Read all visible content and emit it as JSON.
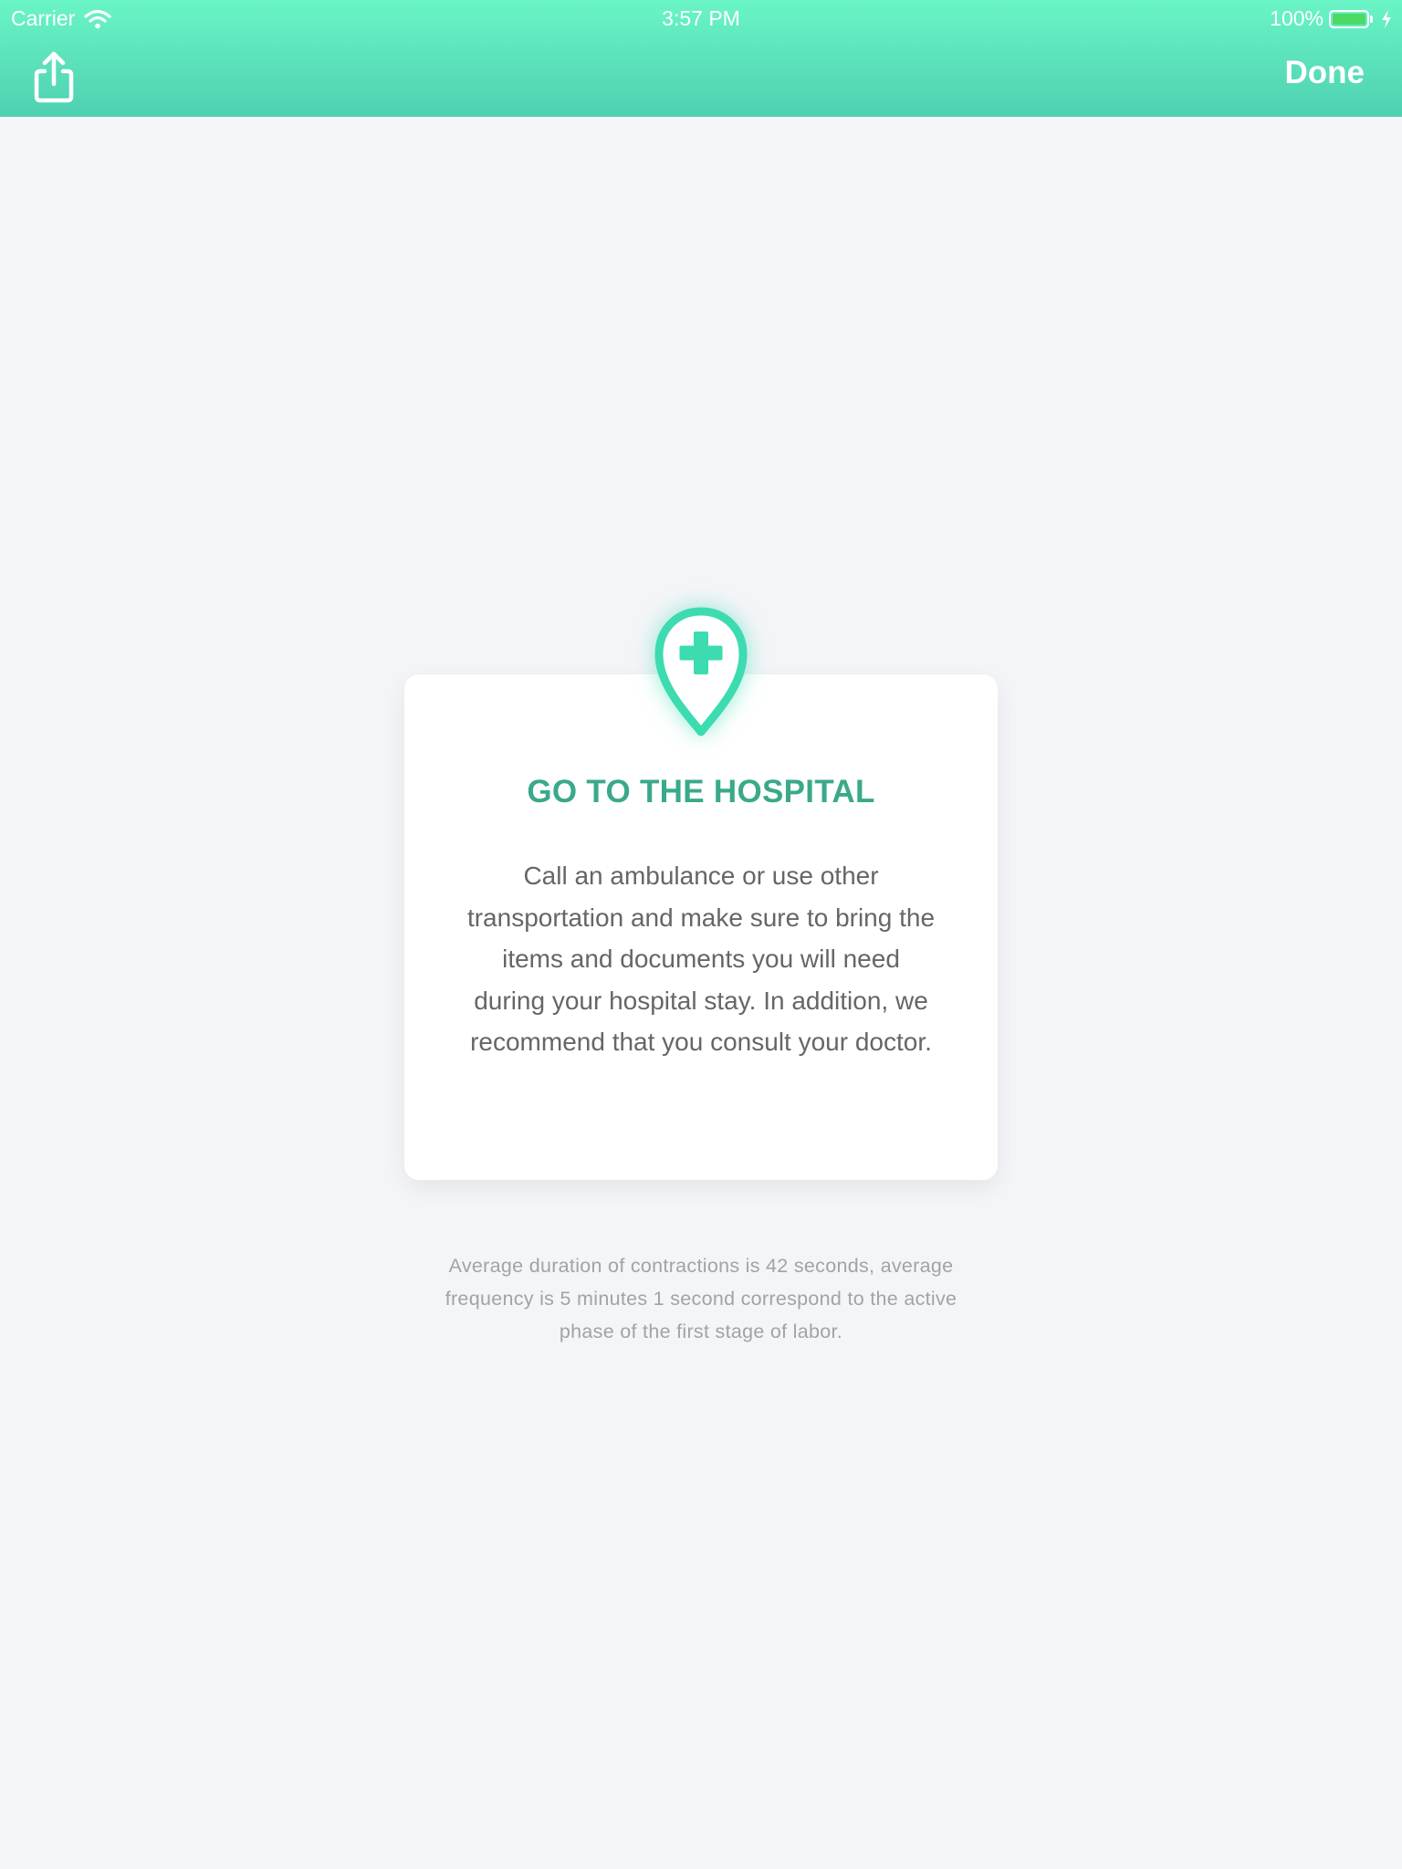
{
  "status_bar": {
    "carrier": "Carrier",
    "time": "3:57 PM",
    "battery_percent": "100%",
    "battery_level": 1.0,
    "charging": true
  },
  "nav": {
    "share_icon": "share-icon",
    "done_label": "Done"
  },
  "card": {
    "icon": "hospital-location-pin-icon",
    "title": "GO TO THE HOSPITAL",
    "body": "Call an ambulance or use other transportation and make sure to bring the items and documents you will need during your hospital stay. In addition, we recommend that you consult your doctor."
  },
  "footnote": "Average duration of contractions is 42 seconds, average frequency is 5 minutes 1 second correspond to the active phase of the first stage of labor.",
  "colors": {
    "header_gradient_top": "#6af5c6",
    "header_gradient_bottom": "#4ed0b1",
    "accent": "#3ddbb0",
    "title": "#3aa98b",
    "background": "#f4f5f8",
    "battery_fill": "#4cd964"
  }
}
